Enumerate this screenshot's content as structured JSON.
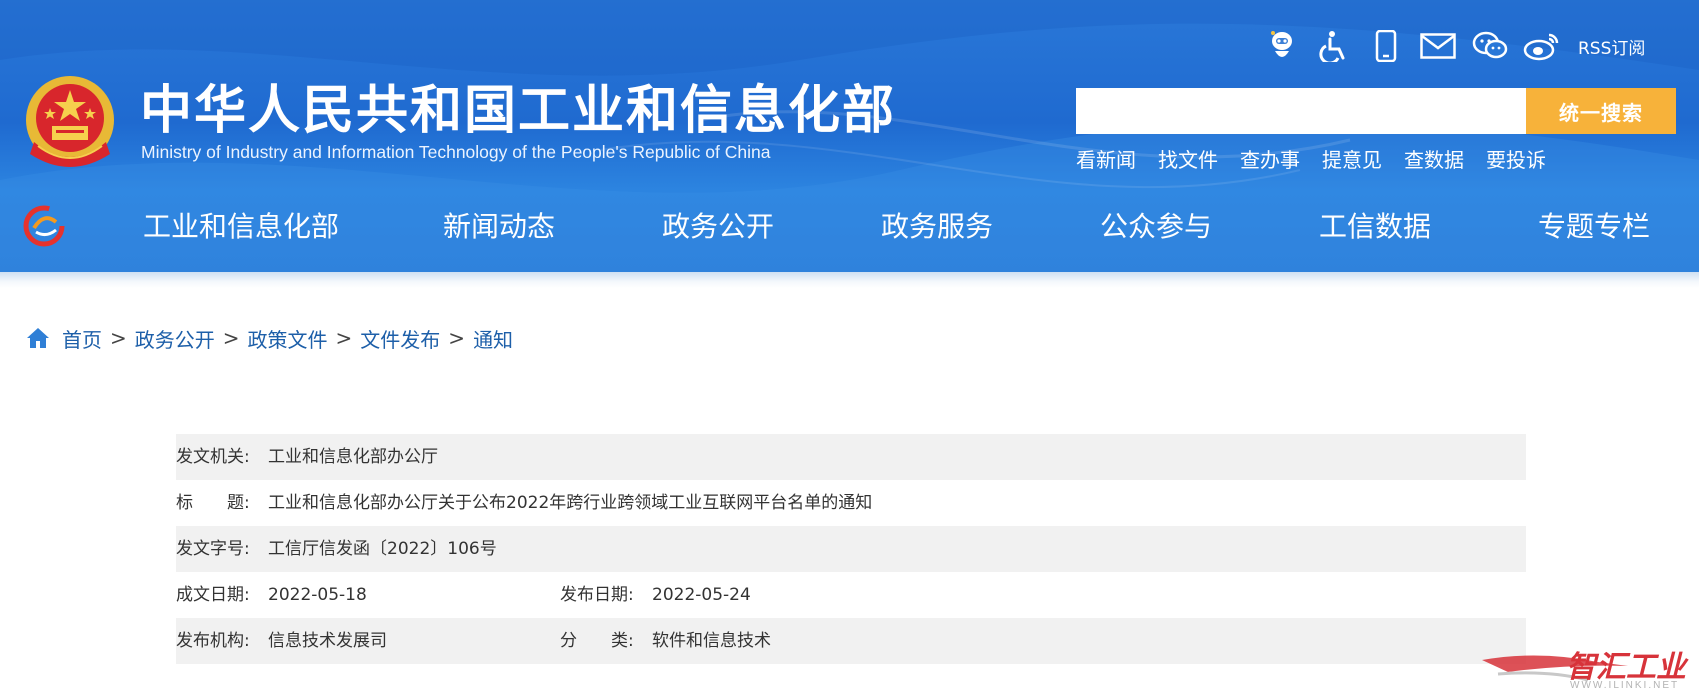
{
  "header": {
    "title_cn": "中华人民共和国工业和信息化部",
    "title_en": "Ministry of Industry and Information Technology of the People's Republic of China",
    "rss_label": "RSS订阅",
    "search": {
      "placeholder": "",
      "button_label": "统一搜索"
    },
    "quick_links": [
      "看新闻",
      "找文件",
      "查办事",
      "提意见",
      "查数据",
      "要投诉"
    ],
    "icons": [
      "robot-assistant-icon",
      "accessibility-icon",
      "mobile-icon",
      "mail-icon",
      "wechat-icon",
      "weibo-icon"
    ]
  },
  "nav": {
    "items": [
      "工业和信息化部",
      "新闻动态",
      "政务公开",
      "政务服务",
      "公众参与",
      "工信数据",
      "专题专栏"
    ]
  },
  "breadcrumb": {
    "items": [
      "首页",
      "政务公开",
      "政策文件",
      "文件发布",
      "通知"
    ],
    "separator": ">"
  },
  "info": {
    "issuer_label": "发文机关:",
    "issuer": "工业和信息化部办公厅",
    "title_label": "标　　题:",
    "title": "工业和信息化部办公厅关于公布2022年跨行业跨领域工业互联网平台名单的通知",
    "doc_no_label": "发文字号:",
    "doc_no": "工信厅信发函〔2022〕106号",
    "written_date_label": "成文日期:",
    "written_date": "2022-05-18",
    "publish_date_label": "发布日期:",
    "publish_date": "2022-05-24",
    "org_label": "发布机构:",
    "org": "信息技术发展司",
    "category_label": "分　　类:",
    "category": "软件和信息技术"
  },
  "watermark": {
    "text": "智汇工业",
    "url": "WWW.ILINKI.NET"
  },
  "colors": {
    "header_blue": "#2a78d8",
    "search_button": "#f7b23a",
    "breadcrumb_link": "#1d5fa9",
    "watermark_red": "#d7333a"
  }
}
